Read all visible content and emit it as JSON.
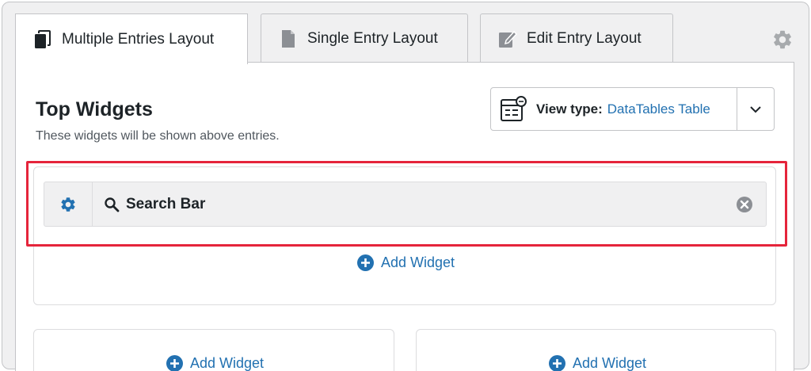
{
  "tabs": [
    {
      "label": "Multiple Entries Layout",
      "icon": "copy-icon",
      "active": true
    },
    {
      "label": "Single Entry Layout",
      "icon": "document-icon",
      "active": false
    },
    {
      "label": "Edit Entry Layout",
      "icon": "edit-icon",
      "active": false
    }
  ],
  "settings_icon": "gear-icon",
  "section": {
    "title": "Top Widgets",
    "subtitle": "These widgets will be shown above entries."
  },
  "view_type": {
    "label": "View type:",
    "value": "DataTables Table",
    "icon": "table-view-icon",
    "dropdown_icon": "chevron-down-icon"
  },
  "widget": {
    "label": "Search Bar",
    "settings_icon": "gear-icon",
    "type_icon": "search-icon",
    "remove_icon": "close-circle-icon"
  },
  "add_widget_label": "Add Widget",
  "colors": {
    "accent": "#2271b1",
    "highlight": "#e5243b",
    "text": "#1d2327",
    "muted": "#50575e",
    "border": "#c3c4c7"
  }
}
